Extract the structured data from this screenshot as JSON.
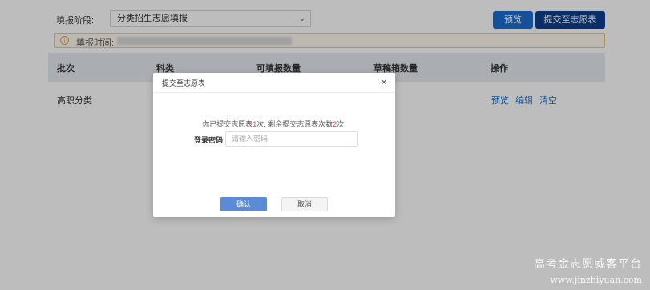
{
  "toolbar": {
    "stage_label": "填报阶段:",
    "stage_value": "分类招生志愿填报",
    "preview_label": "预览",
    "submit_label": "提交至志愿表"
  },
  "notice": {
    "label": "填报时间:"
  },
  "table": {
    "headers": [
      "批次",
      "科类",
      "可填报数量",
      "草稿箱数量",
      "操作"
    ],
    "rows": [
      {
        "batch": "高职分类",
        "actions": [
          "预览",
          "编辑",
          "清空"
        ]
      }
    ]
  },
  "modal": {
    "title": "提交至志愿表",
    "close": "×",
    "message_prefix": "你已提交志愿表",
    "submitted": "1",
    "message_mid": "次, 剩余提交志愿表次数",
    "remaining": "2",
    "message_suffix": "次!",
    "password_label": "登录密码",
    "password_placeholder": "请输入密码",
    "confirm_label": "确认",
    "cancel_label": "取消"
  },
  "watermark": {
    "title": "高考金志愿威客平台",
    "url": "www.jinzhiyuan.com"
  },
  "colors": {
    "primary": "#1a6fd2",
    "primary_dark": "#0d3f8f",
    "accent_red": "#e0464b",
    "warning_border": "#f3c38a"
  }
}
